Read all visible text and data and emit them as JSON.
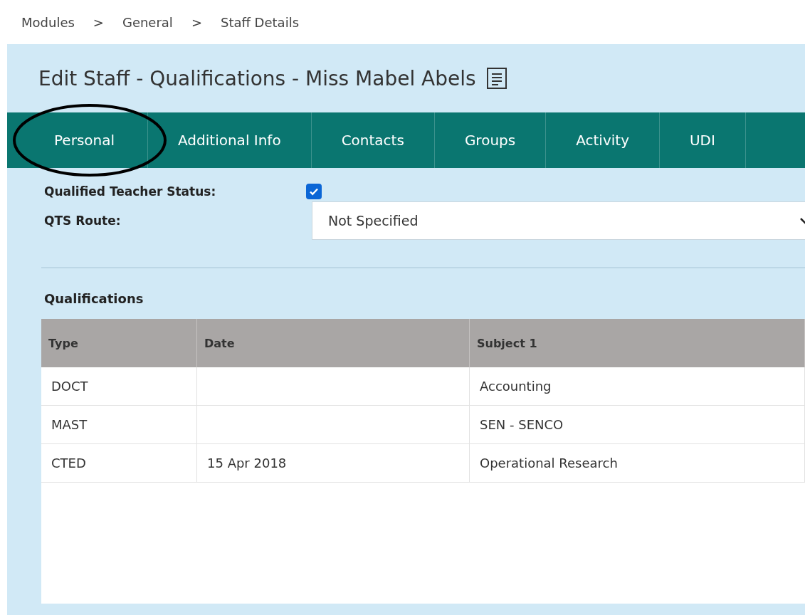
{
  "breadcrumb": [
    "Modules",
    ">",
    "General",
    ">",
    "Staff Details"
  ],
  "title": "Edit Staff - Qualifications - Miss Mabel Abels",
  "tabs": [
    {
      "label": "Personal",
      "circled": true
    },
    {
      "label": "Additional Info",
      "circled": false
    },
    {
      "label": "Contacts",
      "circled": false
    },
    {
      "label": "Groups",
      "circled": false
    },
    {
      "label": "Activity",
      "circled": false
    },
    {
      "label": "UDI",
      "circled": false
    }
  ],
  "form": {
    "qts_label": "Qualified Teacher Status:",
    "qts_checked": true,
    "route_label": "QTS Route:",
    "route_value": "Not Specified"
  },
  "qualifications": {
    "heading": "Qualifications",
    "columns": [
      "Type",
      "Date",
      "Subject 1"
    ],
    "rows": [
      [
        "DOCT",
        "",
        "Accounting"
      ],
      [
        "MAST",
        "",
        "SEN - SENCO"
      ],
      [
        "CTED",
        "15 Apr 2018",
        "Operational Research"
      ]
    ]
  }
}
